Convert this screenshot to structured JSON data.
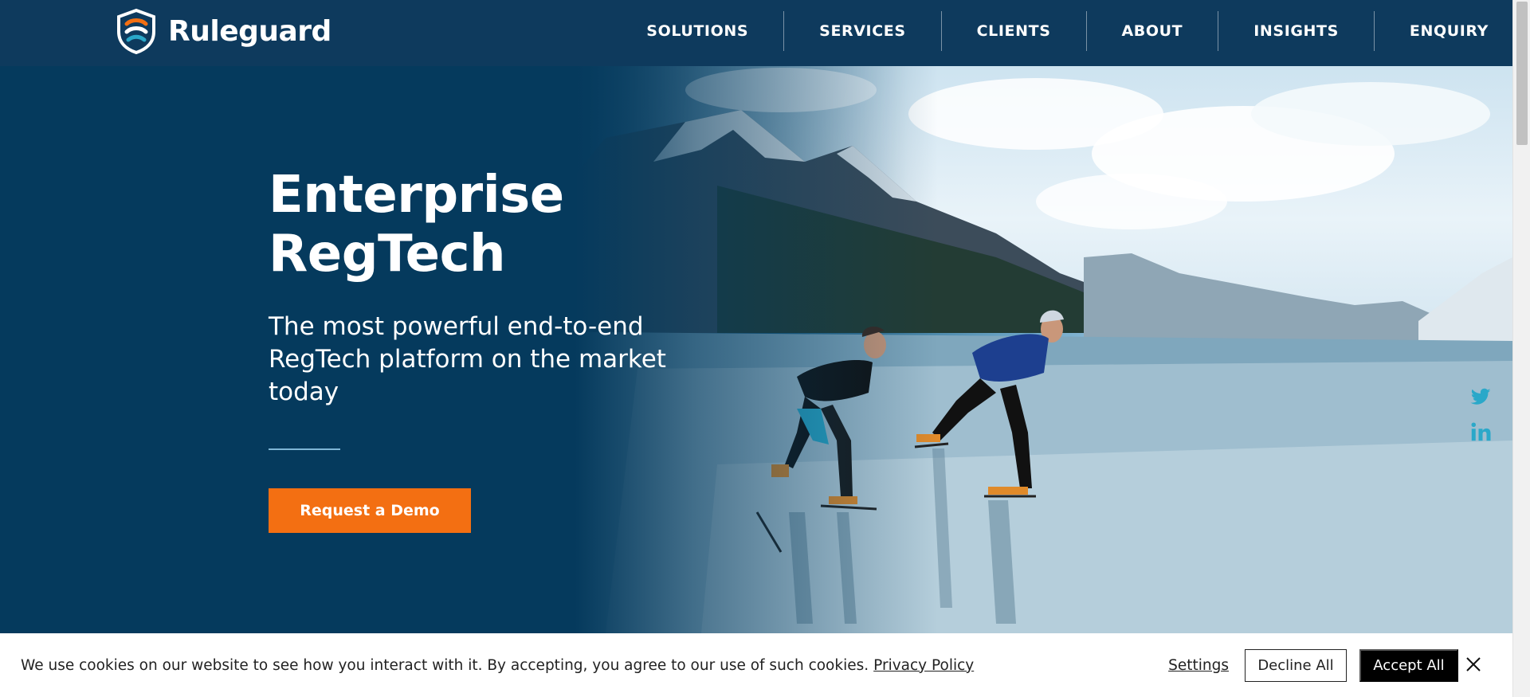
{
  "brand": {
    "name": "Ruleguard"
  },
  "nav": {
    "items": [
      "SOLUTIONS",
      "SERVICES",
      "CLIENTS",
      "ABOUT",
      "INSIGHTS",
      "ENQUIRY"
    ]
  },
  "hero": {
    "title": "Enterprise RegTech",
    "subtitle": "The most powerful end-to-end RegTech platform on the market today",
    "cta_label": "Request a Demo"
  },
  "social": {
    "icons": [
      "twitter-icon",
      "linkedin-icon"
    ]
  },
  "cookie": {
    "message": "We use cookies on our website to see how you interact with it. By accepting, you agree to our use of such cookies.",
    "privacy_link": "Privacy Policy",
    "settings_label": "Settings",
    "decline_label": "Decline All",
    "accept_label": "Accept All"
  },
  "colors": {
    "header_bg": "#0e3a5d",
    "cta_orange": "#f36f12",
    "social_teal": "#2aa8c9"
  }
}
